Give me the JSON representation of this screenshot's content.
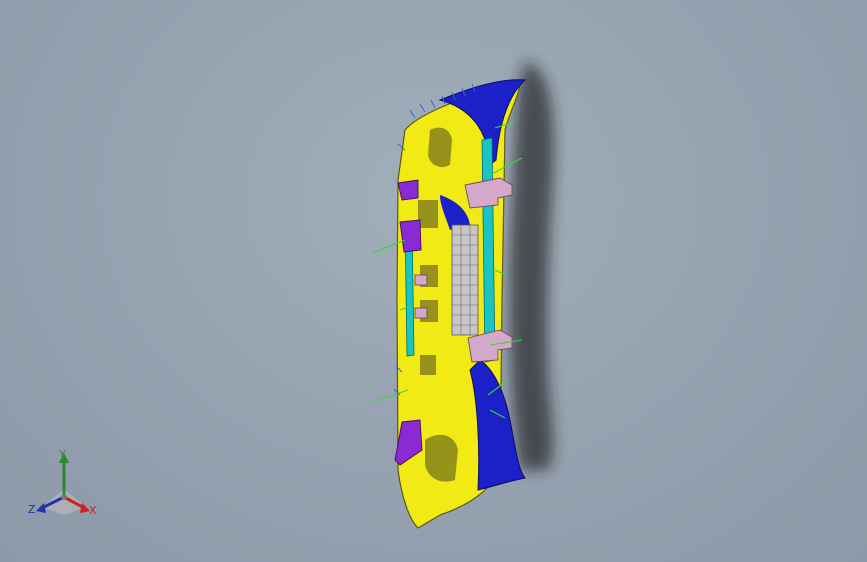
{
  "viewport": {
    "model": "front-bumper-assembly",
    "background_top": "#a3aebb",
    "background_bottom": "#8d99a8",
    "colors": {
      "body": "#f2ea14",
      "body_edge": "#6b6a10",
      "blue": "#1c20c8",
      "cyan": "#19c4c4",
      "purple": "#8a2ad2",
      "pink": "#d4a8c8",
      "grille": "#c6c6c6",
      "shadow": "#1a1a1a",
      "ref_lines": "#3ad63a"
    }
  },
  "triad": {
    "x_label": "X",
    "y_label": "Y",
    "z_label": "Z",
    "x_color": "#cc2222",
    "y_color": "#2c8a2c",
    "z_color": "#2233aa"
  }
}
